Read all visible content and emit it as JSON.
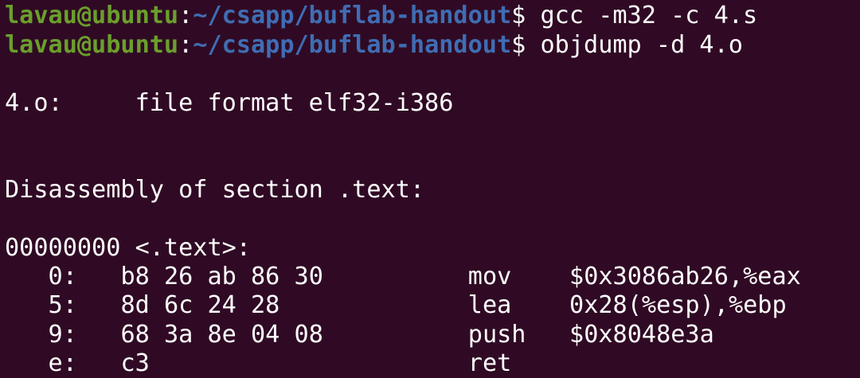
{
  "terminal": {
    "background": "#300a24",
    "prompt_color_user": "#6a9f2c",
    "prompt_color_path": "#3f6db4",
    "prompt": {
      "user": "lavau@ubuntu",
      "sep": ":",
      "path": "~/csapp/buflab-handout",
      "symbol": "$"
    },
    "commands": [
      "gcc -m32 -c 4.s",
      "objdump -d 4.o"
    ],
    "output": {
      "file_header": "4.o:     file format elf32-i386",
      "section_header": "Disassembly of section .text:",
      "symbol": "00000000 <.text>:",
      "instructions": [
        {
          "addr": "   0:",
          "bytes": "b8 26 ab 86 30",
          "mnemonic": "mov",
          "operands": "$0x3086ab26,%eax"
        },
        {
          "addr": "   5:",
          "bytes": "8d 6c 24 28",
          "mnemonic": "lea",
          "operands": "0x28(%esp),%ebp"
        },
        {
          "addr": "   9:",
          "bytes": "68 3a 8e 04 08",
          "mnemonic": "push",
          "operands": "$0x8048e3a"
        },
        {
          "addr": "   e:",
          "bytes": "c3",
          "mnemonic": "ret",
          "operands": ""
        }
      ]
    }
  }
}
